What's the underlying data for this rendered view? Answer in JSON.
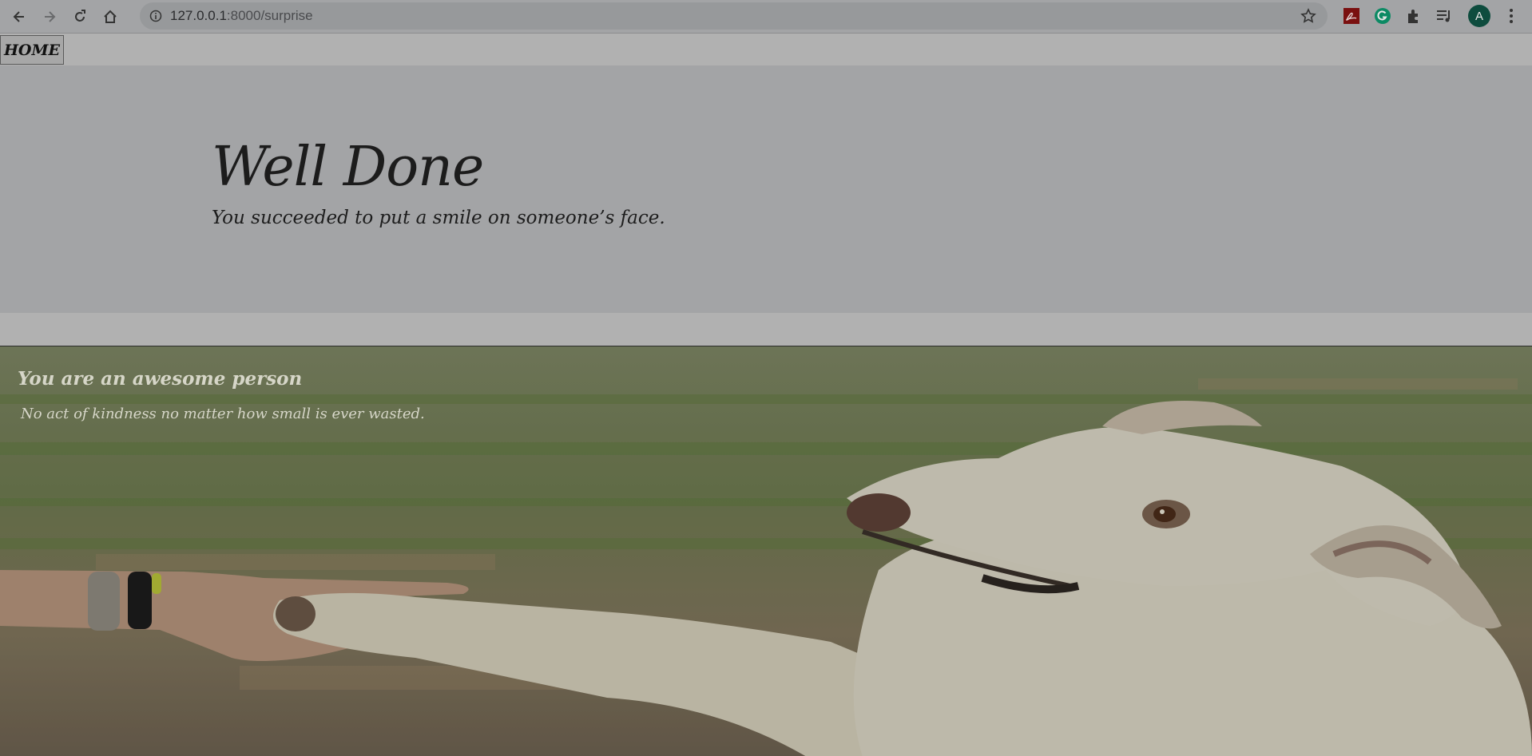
{
  "browser": {
    "url_host": "127.0.0.1",
    "url_path": ":8000/surprise",
    "avatar_letter": "A",
    "icons": [
      "back-icon",
      "forward-icon",
      "reload-icon",
      "home-icon",
      "info-icon",
      "star-icon",
      "pdf-extension-icon",
      "grammarly-extension-icon",
      "extensions-puzzle-icon",
      "media-queue-icon",
      "kebab-menu-icon"
    ]
  },
  "nav": {
    "home_label": "HOME"
  },
  "hero": {
    "title": "Well Done",
    "subtitle": "You succeeded to put a smile on someone’s face."
  },
  "card": {
    "title": "You are an awesome person",
    "text": "No act of kindness no matter how small is ever wasted.",
    "image_subject": "hand-holding-dog-paw-photo"
  },
  "colors": {
    "hero_bg": "#a3a4a6",
    "page_bg": "#b1b1b1",
    "text_dark": "#1c1c1c",
    "caption_text": "#d6d6c8"
  }
}
